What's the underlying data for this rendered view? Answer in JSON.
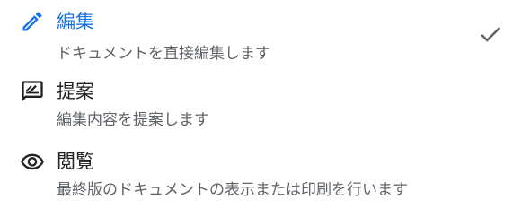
{
  "menu": {
    "items": [
      {
        "id": "edit",
        "icon": "pencil-icon",
        "title": "編集",
        "description": "ドキュメントを直接編集します",
        "selected": true
      },
      {
        "id": "suggest",
        "icon": "suggest-edit-icon",
        "title": "提案",
        "description": "編集内容を提案します",
        "selected": false
      },
      {
        "id": "view",
        "icon": "eye-icon",
        "title": "閲覧",
        "description": "最終版のドキュメントの表示または印刷を行います",
        "selected": false
      }
    ]
  },
  "colors": {
    "accent": "#1a73e8",
    "title_text": "#202124",
    "secondary_text": "#5f6368",
    "icon": "#5f6368",
    "background": "#ffffff"
  }
}
